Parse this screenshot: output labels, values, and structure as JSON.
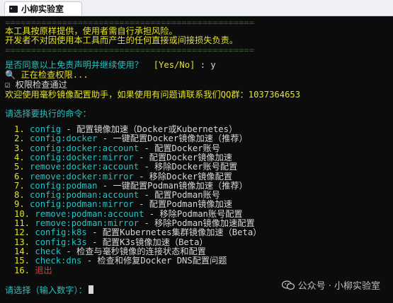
{
  "window": {
    "tab_title": "小柳实验室"
  },
  "colors": {
    "terminal_bg": "#0c0c0c",
    "yellow": "#e3e327",
    "cyan": "#25c3c3",
    "white": "#d8d8d8",
    "red": "#e03a3a"
  },
  "header": {
    "separator": "================================================",
    "line1": "本工具按原样提供，使用者需自行承担风险。",
    "line2": "开发者不对因使用本工具而产生的任何直接或间接损失负责。"
  },
  "prompt": {
    "question": "是否同意以上免责声明并继续使用？",
    "yes_no": "[Yes/No]",
    "answer": ": y",
    "checking": "正在检查权限...",
    "passed": "权限检查通过",
    "welcome": "欢迎使用毫秒镜像配置助手，如果使用有问题请联系我们QQ群：1037364653"
  },
  "menu": {
    "heading": "请选择要执行的命令：",
    "items": [
      {
        "num": "1.",
        "cmd": "config",
        "desc": " - 配置镜像加速（Docker或Kubernetes）"
      },
      {
        "num": "2.",
        "cmd": "config:docker",
        "desc": " - 一键配置Docker镜像加速（推荐）"
      },
      {
        "num": "3.",
        "cmd": "config:docker:account",
        "desc": " - 配置Docker账号"
      },
      {
        "num": "4.",
        "cmd": "config:docker:mirror",
        "desc": " - 配置Docker镜像加速"
      },
      {
        "num": "5.",
        "cmd": "remove:docker:account",
        "desc": " - 移除Docker账号配置"
      },
      {
        "num": "6.",
        "cmd": "remove:docker:mirror",
        "desc": " - 移除Docker镜像配置"
      },
      {
        "num": "7.",
        "cmd": "config:podman",
        "desc": " - 一键配置Podman镜像加速（推荐）"
      },
      {
        "num": "8.",
        "cmd": "config:podman:account",
        "desc": " - 配置Podman账号"
      },
      {
        "num": "9.",
        "cmd": "config:podman:mirror",
        "desc": " - 配置Podman镜像加速"
      },
      {
        "num": "10.",
        "cmd": "remove:podman:account",
        "desc": " - 移除Podman账号配置"
      },
      {
        "num": "11.",
        "cmd": "remove:podman:mirror",
        "desc": " - 移除Podman镜像加速配置"
      },
      {
        "num": "12.",
        "cmd": "config:k8s",
        "desc": " - 配置Kubernetes集群镜像加速（Beta）"
      },
      {
        "num": "13.",
        "cmd": "config:k3s",
        "desc": " - 配置K3s镜像加速（Beta）"
      },
      {
        "num": "14.",
        "cmd": "check",
        "desc": " - 检查与毫秒镜像的连接状态和配置"
      },
      {
        "num": "15.",
        "cmd": "check:dns",
        "desc": " - 检查和修复Docker DNS配置问题"
      },
      {
        "num": "16.",
        "cmd": "",
        "desc": "",
        "exit": "退出"
      }
    ]
  },
  "input_prompt": "请选择（输入数字）：",
  "watermark": "公众号 · 小柳实验室"
}
